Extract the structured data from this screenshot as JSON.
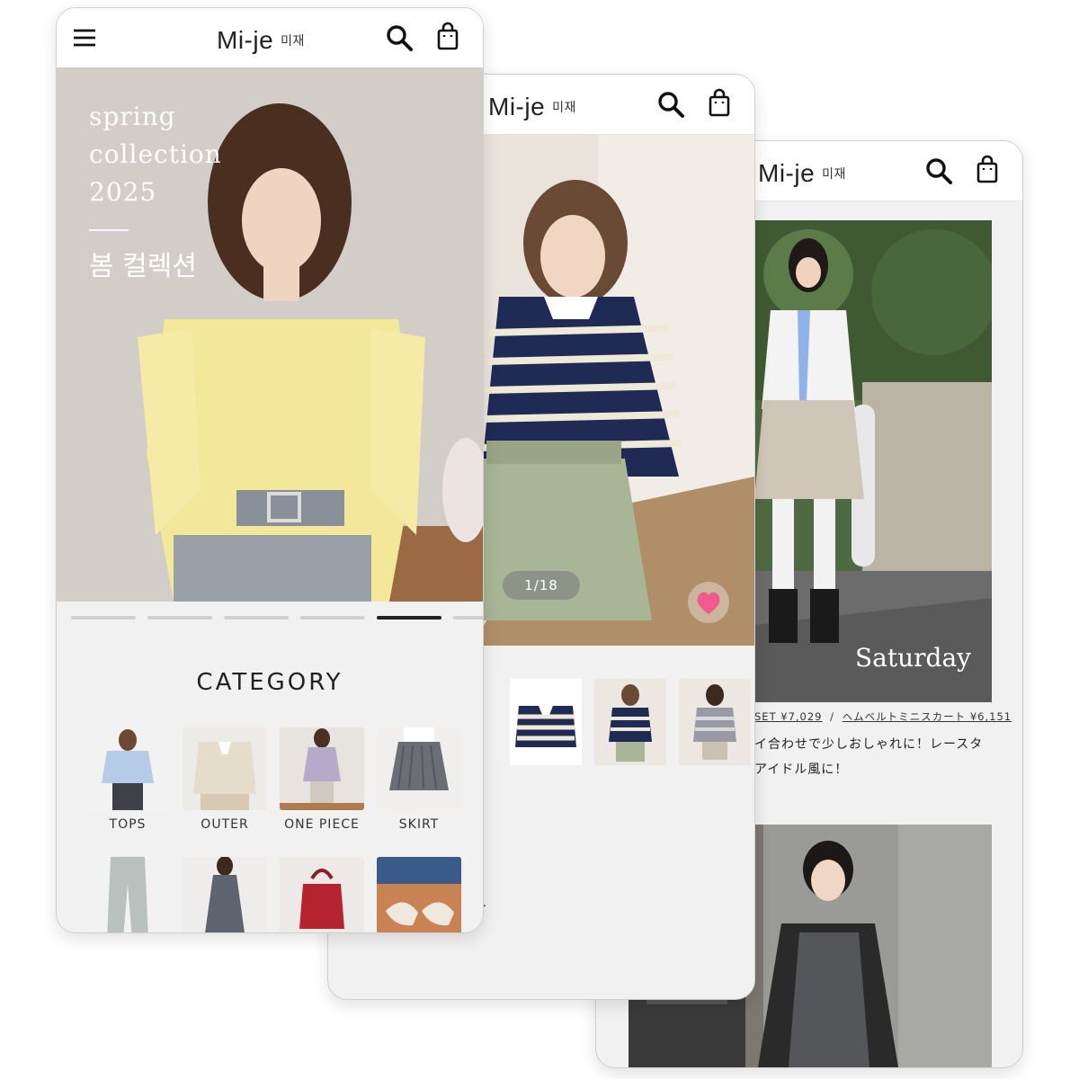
{
  "brand": {
    "name": "Mi-je",
    "korean": "미재"
  },
  "phone1": {
    "hero": {
      "line1": "spring",
      "line2": "collection",
      "line3": "2025",
      "korean": "봄 컬렉션"
    },
    "category_title": "CATEGORY",
    "categories": [
      "TOPS",
      "OUTER",
      "ONE PIECE",
      "SKIRT"
    ]
  },
  "phone2": {
    "counter": "1/18",
    "extra_text": "1"
  },
  "phone3": {
    "overlay": "Saturday",
    "product_left": "SET ¥7,029",
    "separator": "/",
    "product_right": "ヘムベルトミニスカート ¥6,151",
    "caption_line1": "イ合わせで少しおしゃれに！レースタ",
    "caption_line2": "アイドル風に！"
  },
  "colors": {
    "accent_heart": "#f05a8c",
    "page_bg": "#f1f1f1",
    "text": "#222222"
  },
  "icons": [
    "menu-icon",
    "search-icon",
    "shopping-bag-icon",
    "heart-icon"
  ]
}
